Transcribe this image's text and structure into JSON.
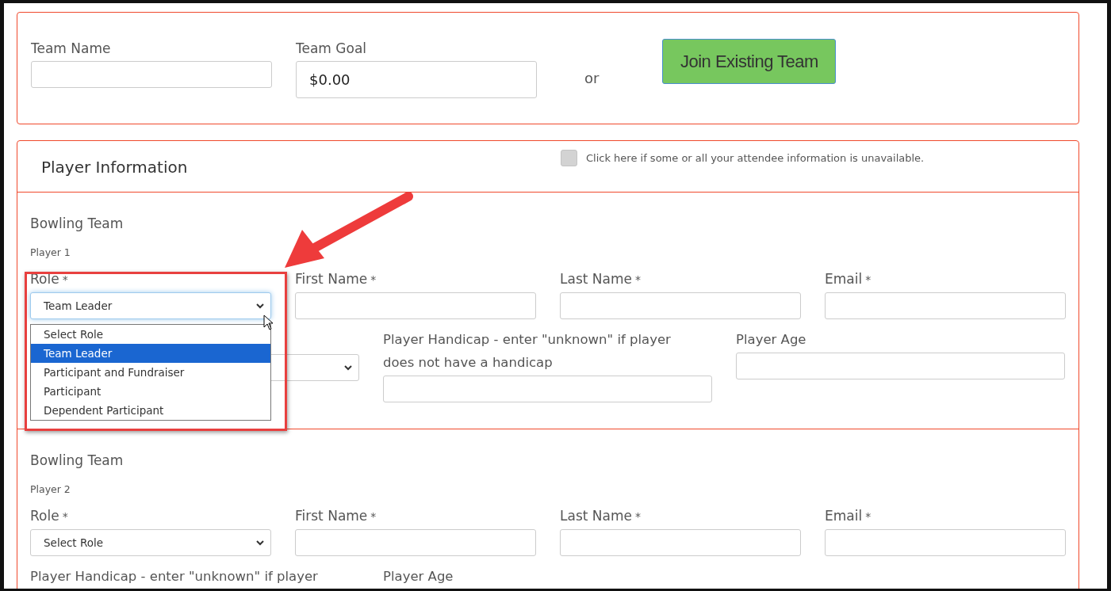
{
  "team": {
    "name_label": "Team Name",
    "goal_label": "Team Goal",
    "goal_value": "$0.00",
    "or_text": "or",
    "join_button": "Join Existing Team"
  },
  "player_information": {
    "title": "Player Information",
    "unavailable": {
      "label": "Click here if some or all your attendee information is unavailable.",
      "checked": false
    },
    "players": [
      {
        "team_label": "Bowling Team",
        "player_label": "Player 1",
        "row_1": [
          {
            "kind": "select",
            "label": "Role",
            "mark": "*",
            "value": "Team Leader",
            "open": true,
            "options": [
              {
                "label": "Select Role",
                "selected": false
              },
              {
                "label": "Team Leader",
                "selected": true
              },
              {
                "label": "Participant and Fundraiser",
                "selected": false
              },
              {
                "label": "Participant",
                "selected": false
              },
              {
                "label": "Dependent Participant",
                "selected": false
              }
            ]
          },
          {
            "kind": "text",
            "label": "First Name",
            "mark": "*"
          },
          {
            "kind": "text",
            "label": "Last Name",
            "mark": "*"
          },
          {
            "kind": "text",
            "label": "Email",
            "mark": "*"
          }
        ],
        "row_2": [
          {
            "kind": "select"
          },
          {
            "kind": "text",
            "label": "Player Handicap - enter \"unknown\" if player does not have a handicap"
          },
          {
            "kind": "text",
            "label": "Player Age"
          }
        ]
      },
      {
        "team_label": "Bowling Team",
        "player_label": "Player 2",
        "row_1": [
          {
            "kind": "select",
            "label": "Role",
            "mark": "*",
            "value": "Select Role",
            "open": false
          },
          {
            "kind": "text",
            "label": "First Name",
            "mark": "*"
          },
          {
            "kind": "text",
            "label": "Last Name",
            "mark": "*"
          },
          {
            "kind": "text",
            "label": "Email",
            "mark": "*"
          }
        ],
        "row_2": [
          {
            "kind": "label",
            "label": "Player Handicap - enter \"unknown\" if player"
          },
          {
            "kind": "label",
            "label": "Player Age"
          }
        ]
      }
    ]
  }
}
